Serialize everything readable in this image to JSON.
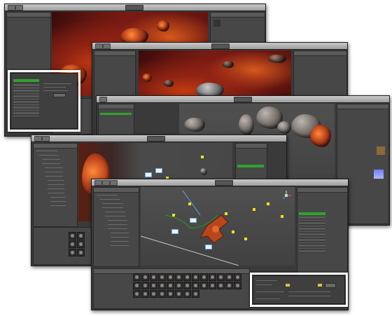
{
  "windows": [
    {
      "id": "w1",
      "label": ""
    },
    {
      "id": "w2",
      "label": ""
    },
    {
      "id": "w3",
      "label": ""
    },
    {
      "id": "w4",
      "label": ""
    },
    {
      "id": "w5",
      "label": ""
    }
  ],
  "dialogs": {
    "highlight_label": "",
    "rows_count_note": ""
  },
  "colors": {
    "accent_green": "#2fa32f",
    "selection_blue": "#3d6fb5",
    "lightbox_border": "#ffffff",
    "editor_bg": "#3a3a3a"
  },
  "icons": [
    "play-icon",
    "pause-icon",
    "step-icon",
    "move-tool-icon",
    "rotate-tool-icon",
    "scale-tool-icon",
    "axis-gizmo-icon",
    "camera-icon"
  ]
}
